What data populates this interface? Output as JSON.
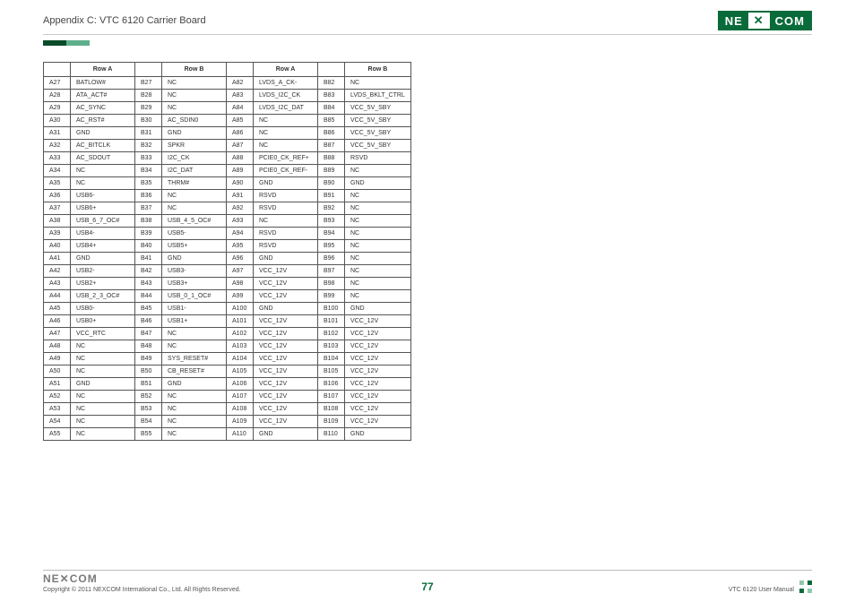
{
  "header": {
    "title": "Appendix C: VTC 6120 Carrier Board",
    "logo_ne": "NE",
    "logo_com": "COM",
    "logo_x": "✕"
  },
  "table": {
    "headers": [
      "Row A",
      "Row B",
      "Row A",
      "Row B"
    ],
    "rows": [
      [
        "A27",
        "BATLOW#",
        "B27",
        "NC",
        "A82",
        "LVDS_A_CK-",
        "B82",
        "NC"
      ],
      [
        "A28",
        "ATA_ACT#",
        "B28",
        "NC",
        "A83",
        "LVDS_I2C_CK",
        "B83",
        "LVDS_BKLT_CTRL"
      ],
      [
        "A29",
        "AC_SYNC",
        "B29",
        "NC",
        "A84",
        "LVDS_I2C_DAT",
        "B84",
        "VCC_5V_SBY"
      ],
      [
        "A30",
        "AC_RST#",
        "B30",
        "AC_SDIN0",
        "A85",
        "NC",
        "B85",
        "VCC_5V_SBY"
      ],
      [
        "A31",
        "GND",
        "B31",
        "GND",
        "A86",
        "NC",
        "B86",
        "VCC_5V_SBY"
      ],
      [
        "A32",
        "AC_BITCLK",
        "B32",
        "SPKR",
        "A87",
        "NC",
        "B87",
        "VCC_5V_SBY"
      ],
      [
        "A33",
        "AC_SDOUT",
        "B33",
        "I2C_CK",
        "A88",
        "PCIE0_CK_REF+",
        "B88",
        "RSVD"
      ],
      [
        "A34",
        "NC",
        "B34",
        "I2C_DAT",
        "A89",
        "PCIE0_CK_REF-",
        "B89",
        "NC"
      ],
      [
        "A35",
        "NC",
        "B35",
        "THRM#",
        "A90",
        "GND",
        "B90",
        "GND"
      ],
      [
        "A36",
        "USB6-",
        "B36",
        "NC",
        "A91",
        "RSVD",
        "B91",
        "NC"
      ],
      [
        "A37",
        "USB6+",
        "B37",
        "NC",
        "A92",
        "RSVD",
        "B92",
        "NC"
      ],
      [
        "A38",
        "USB_6_7_OC#",
        "B38",
        "USB_4_5_OC#",
        "A93",
        "NC",
        "B93",
        "NC"
      ],
      [
        "A39",
        "USB4-",
        "B39",
        "USB5-",
        "A94",
        "RSVD",
        "B94",
        "NC"
      ],
      [
        "A40",
        "USB4+",
        "B40",
        "USB5+",
        "A95",
        "RSVD",
        "B95",
        "NC"
      ],
      [
        "A41",
        "GND",
        "B41",
        "GND",
        "A96",
        "GND",
        "B96",
        "NC"
      ],
      [
        "A42",
        "USB2-",
        "B42",
        "USB3-",
        "A97",
        "VCC_12V",
        "B97",
        "NC"
      ],
      [
        "A43",
        "USB2+",
        "B43",
        "USB3+",
        "A98",
        "VCC_12V",
        "B98",
        "NC"
      ],
      [
        "A44",
        "USB_2_3_OC#",
        "B44",
        "USB_0_1_OC#",
        "A99",
        "VCC_12V",
        "B99",
        "NC"
      ],
      [
        "A45",
        "USB0-",
        "B45",
        "USB1-",
        "A100",
        "GND",
        "B100",
        "GND"
      ],
      [
        "A46",
        "USB0+",
        "B46",
        "USB1+",
        "A101",
        "VCC_12V",
        "B101",
        "VCC_12V"
      ],
      [
        "A47",
        "VCC_RTC",
        "B47",
        "NC",
        "A102",
        "VCC_12V",
        "B102",
        "VCC_12V"
      ],
      [
        "A48",
        "NC",
        "B48",
        "NC",
        "A103",
        "VCC_12V",
        "B103",
        "VCC_12V"
      ],
      [
        "A49",
        "NC",
        "B49",
        "SYS_RESET#",
        "A104",
        "VCC_12V",
        "B104",
        "VCC_12V"
      ],
      [
        "A50",
        "NC",
        "B50",
        "CB_RESET#",
        "A105",
        "VCC_12V",
        "B105",
        "VCC_12V"
      ],
      [
        "A51",
        "GND",
        "B51",
        "GND",
        "A106",
        "VCC_12V",
        "B106",
        "VCC_12V"
      ],
      [
        "A52",
        "NC",
        "B52",
        "NC",
        "A107",
        "VCC_12V",
        "B107",
        "VCC_12V"
      ],
      [
        "A53",
        "NC",
        "B53",
        "NC",
        "A108",
        "VCC_12V",
        "B108",
        "VCC_12V"
      ],
      [
        "A54",
        "NC",
        "B54",
        "NC",
        "A109",
        "VCC_12V",
        "B109",
        "VCC_12V"
      ],
      [
        "A55",
        "NC",
        "B55",
        "NC",
        "A110",
        "GND",
        "B110",
        "GND"
      ]
    ]
  },
  "footer": {
    "logo": "NE✕COM",
    "copyright": "Copyright © 2011 NEXCOM International Co., Ltd. All Rights Reserved.",
    "page": "77",
    "manual": "VTC 6120 User Manual"
  }
}
